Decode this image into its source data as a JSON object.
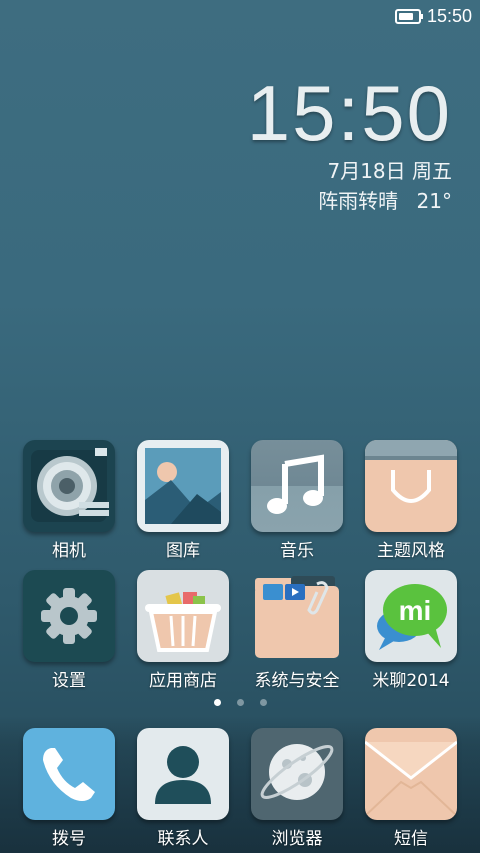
{
  "status_bar": {
    "time": "15:50",
    "battery_level": 0.9
  },
  "clock_widget": {
    "time": "15:50",
    "date": "7月18日 周五",
    "weather": "阵雨转晴",
    "temperature": "21°"
  },
  "pager": {
    "pages": 3,
    "active": 0
  },
  "rows": [
    [
      {
        "label": "相机",
        "icon": "camera-icon"
      },
      {
        "label": "图库",
        "icon": "gallery-icon"
      },
      {
        "label": "音乐",
        "icon": "music-icon"
      },
      {
        "label": "主题风格",
        "icon": "theme-icon"
      }
    ],
    [
      {
        "label": "设置",
        "icon": "settings-icon"
      },
      {
        "label": "应用商店",
        "icon": "app-store-icon"
      },
      {
        "label": "系统与安全",
        "icon": "system-security-folder-icon"
      },
      {
        "label": "米聊2014",
        "icon": "miliao-icon"
      }
    ]
  ],
  "dock": [
    {
      "label": "拨号",
      "icon": "phone-icon"
    },
    {
      "label": "联系人",
      "icon": "contacts-icon"
    },
    {
      "label": "浏览器",
      "icon": "browser-icon"
    },
    {
      "label": "短信",
      "icon": "sms-icon"
    }
  ]
}
